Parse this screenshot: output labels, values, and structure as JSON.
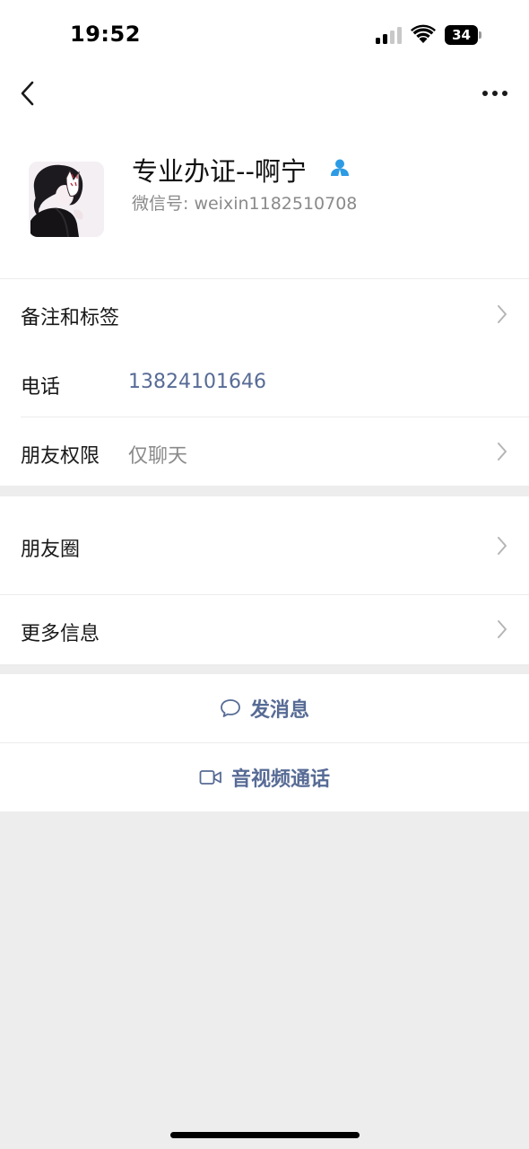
{
  "status_bar": {
    "time": "19:52",
    "battery_level": "34",
    "signal_bars": 2,
    "signal_total": 4
  },
  "nav": {
    "back_icon": "chevron-left-icon",
    "more_icon": "more-dots-icon"
  },
  "profile": {
    "name": "专业办证--啊宁",
    "wechat_id": "微信号: weixin1182510708",
    "badge_icon": "contact-person-icon",
    "badge_color": "#2d9be4"
  },
  "rows": {
    "remarks": {
      "label": "备注和标签"
    },
    "phone": {
      "label": "电话",
      "value": "13824101646",
      "value_color": "#576b95"
    },
    "permissions": {
      "label": "朋友权限",
      "value": "仅聊天",
      "value_color": "#8a8a8a"
    },
    "moments": {
      "label": "朋友圈"
    },
    "more_info": {
      "label": "更多信息"
    }
  },
  "actions": {
    "message": {
      "label": "发消息",
      "icon": "chat-bubble-icon"
    },
    "call": {
      "label": "音视频通话",
      "icon": "video-camera-icon"
    }
  },
  "colors": {
    "link_blue": "#576b95",
    "background": "#ededed",
    "card": "#ffffff",
    "secondary_text": "#8a8a8a"
  }
}
